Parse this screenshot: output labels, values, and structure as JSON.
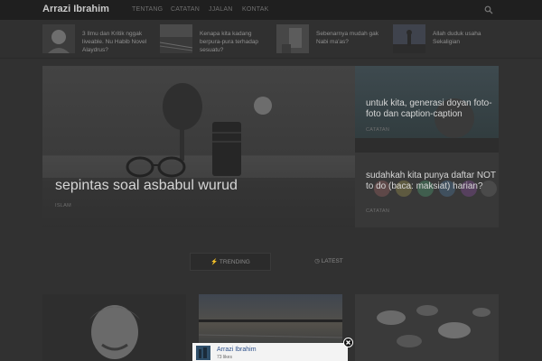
{
  "header": {
    "site_title": "Arrazi Ibrahim",
    "nav": [
      "TENTANG",
      "CATATAN",
      "JJALAN",
      "KONTAK"
    ]
  },
  "strip": [
    {
      "text": "3 Ilmu dan Kritik nggak liveable. Nu Habib Novel Alaydrus?"
    },
    {
      "text": "Kenapa kita kadang berpura-pura terhadap sesuatu?"
    },
    {
      "text": "Sebenarnya mudah gak Nabi ma'as?"
    },
    {
      "text": "Allah duduk usaha Sekaligian"
    }
  ],
  "hero": {
    "main": {
      "title": "sepintas soal asbabul wurud",
      "category": "ISLAM"
    },
    "side": [
      {
        "title": "untuk kita, generasi doyan foto-foto dan caption-caption",
        "category": "CATATAN"
      },
      {
        "title": "sudahkah kita punya daftar NOT to do (baca: maksiat) harian?",
        "category": "CATATAN"
      }
    ]
  },
  "tabs": [
    "TRENDING",
    "LATEST"
  ],
  "popup": {
    "page_name": "Arrazi Ibrahim",
    "likes": "73 likes"
  },
  "colors": {
    "accent_link": "#2c4f8a",
    "overlay_dark": "#313131"
  }
}
